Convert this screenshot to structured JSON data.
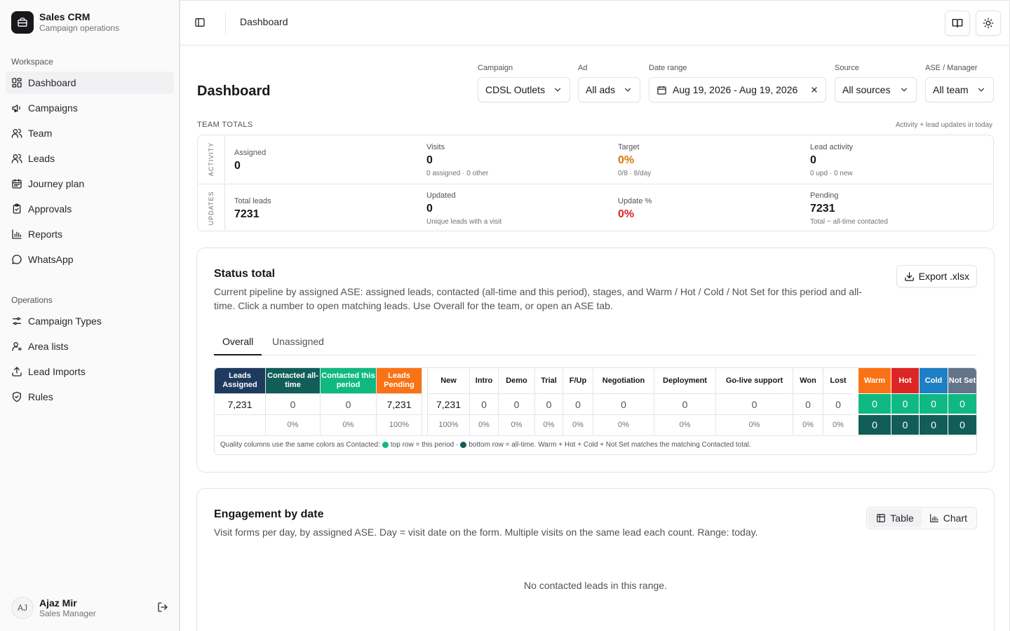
{
  "app": {
    "title": "Sales CRM",
    "subtitle": "Campaign operations"
  },
  "nav": {
    "workspace_label": "Workspace",
    "workspace": [
      {
        "label": "Dashboard",
        "icon": "dashboard-icon",
        "active": true
      },
      {
        "label": "Campaigns",
        "icon": "megaphone-icon"
      },
      {
        "label": "Team",
        "icon": "users-icon"
      },
      {
        "label": "Leads",
        "icon": "users-icon"
      },
      {
        "label": "Journey plan",
        "icon": "calendar-icon"
      },
      {
        "label": "Approvals",
        "icon": "clipboard-check-icon"
      },
      {
        "label": "Reports",
        "icon": "bar-chart-icon"
      },
      {
        "label": "WhatsApp",
        "icon": "message-circle-icon"
      }
    ],
    "operations_label": "Operations",
    "operations": [
      {
        "label": "Campaign Types",
        "icon": "sliders-icon"
      },
      {
        "label": "Area lists",
        "icon": "user-list-icon"
      },
      {
        "label": "Lead Imports",
        "icon": "upload-icon"
      },
      {
        "label": "Rules",
        "icon": "shield-check-icon"
      }
    ]
  },
  "user": {
    "initials": "AJ",
    "name": "Ajaz Mir",
    "role": "Sales Manager"
  },
  "topbar": {
    "title": "Dashboard"
  },
  "page": {
    "title": "Dashboard"
  },
  "filters": {
    "campaign": {
      "label": "Campaign",
      "value": "CDSL Outlets"
    },
    "ad": {
      "label": "Ad",
      "value": "All ads"
    },
    "date_range": {
      "label": "Date range",
      "value": "Aug 19, 2026 - Aug 19, 2026"
    },
    "source": {
      "label": "Source",
      "value": "All sources"
    },
    "ase": {
      "label": "ASE / Manager",
      "value": "All team"
    }
  },
  "team_totals": {
    "label": "TEAM TOTALS",
    "note": "Activity + lead updates in today",
    "activity": {
      "rail": "ACTIVITY",
      "assigned": {
        "label": "Assigned",
        "value": "0"
      },
      "visits": {
        "label": "Visits",
        "value": "0",
        "sub": "0 assigned · 0 other"
      },
      "target": {
        "label": "Target",
        "value": "0%",
        "sub": "0/8 · 8/day"
      },
      "lead_activity": {
        "label": "Lead activity",
        "value": "0",
        "sub": "0 upd · 0 new"
      }
    },
    "updates": {
      "rail": "UPDATES",
      "total_leads": {
        "label": "Total leads",
        "value": "7231"
      },
      "updated": {
        "label": "Updated",
        "value": "0",
        "sub": "Unique leads with a visit"
      },
      "update_pct": {
        "label": "Update %",
        "value": "0%"
      },
      "pending": {
        "label": "Pending",
        "value": "7231",
        "sub": "Total − all-time contacted"
      }
    }
  },
  "status": {
    "title": "Status total",
    "description": "Current pipeline by assigned ASE: assigned leads, contacted (all-time and this period), stages, and Warm / Hot / Cold / Not Set for this period and all-time. Click a number to open matching leads. Use Overall for the team, or open an ASE tab.",
    "export_label": "Export .xlsx",
    "tabs": [
      "Overall",
      "Unassigned"
    ],
    "summary": [
      {
        "header": "Leads Assigned",
        "value": "7,231",
        "pct": ""
      },
      {
        "header": "Contacted all-time",
        "value": "0",
        "pct": "0%"
      },
      {
        "header": "Contacted this period",
        "value": "0",
        "pct": "0%"
      },
      {
        "header": "Leads Pending",
        "value": "7,231",
        "pct": "100%"
      }
    ],
    "stages": [
      {
        "header": "New",
        "value": "7,231",
        "pct": "100%"
      },
      {
        "header": "Intro",
        "value": "0",
        "pct": "0%"
      },
      {
        "header": "Demo",
        "value": "0",
        "pct": "0%"
      },
      {
        "header": "Trial",
        "value": "0",
        "pct": "0%"
      },
      {
        "header": "F/Up",
        "value": "0",
        "pct": "0%"
      },
      {
        "header": "Negotiation",
        "value": "0",
        "pct": "0%"
      },
      {
        "header": "Deployment",
        "value": "0",
        "pct": "0%"
      },
      {
        "header": "Go-live support",
        "value": "0",
        "pct": "0%"
      },
      {
        "header": "Won",
        "value": "0",
        "pct": "0%"
      },
      {
        "header": "Lost",
        "value": "0",
        "pct": "0%"
      }
    ],
    "quality": [
      {
        "header": "Warm",
        "top": "0",
        "bottom": "0"
      },
      {
        "header": "Hot",
        "top": "0",
        "bottom": "0"
      },
      {
        "header": "Cold",
        "top": "0",
        "bottom": "0"
      },
      {
        "header": "Not Set",
        "top": "0",
        "bottom": "0"
      }
    ],
    "note_prefix": "Quality columns use the same colors as Contacted:",
    "note_top": "top row = this period ·",
    "note_bottom": "bottom row = all-time.",
    "note_suffix": "Warm + Hot + Cold + Not Set matches the matching Contacted total.",
    "colors": {
      "navy": "#1e3a5f",
      "teal": "#115e59",
      "green": "#10b981",
      "orange": "#f97316",
      "warm": "#f97316",
      "hot": "#dc2626",
      "cold": "#1d7fc4",
      "notset": "#64748b",
      "q_top": "#10b981",
      "q_bottom": "#115e59"
    }
  },
  "engagement": {
    "title": "Engagement by date",
    "description": "Visit forms per day, by assigned ASE. Day = visit date on the form. Multiple visits on the same lead each count. Range: today.",
    "view_table": "Table",
    "view_chart": "Chart",
    "empty": "No contacted leads in this range."
  }
}
